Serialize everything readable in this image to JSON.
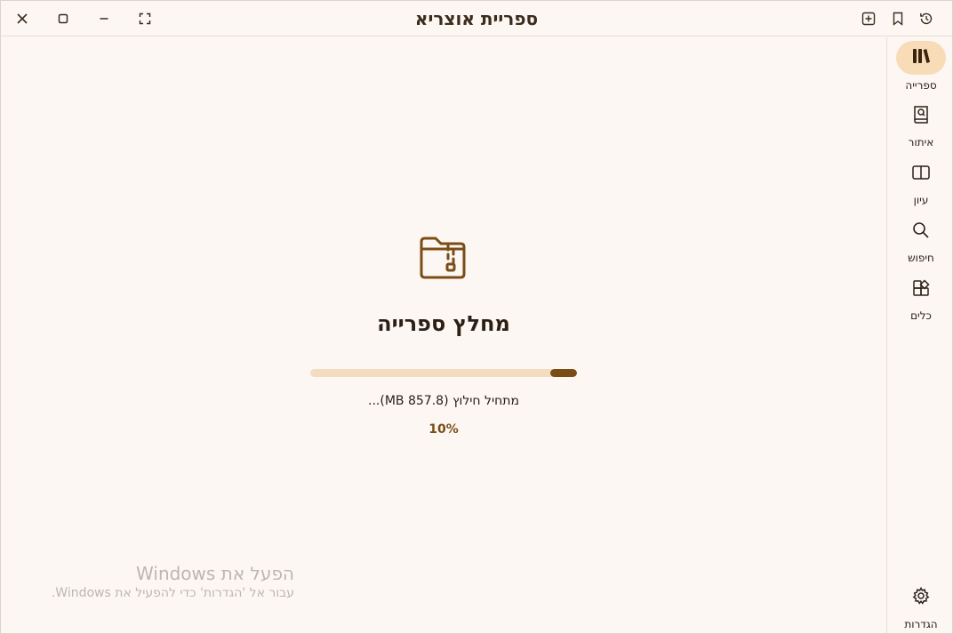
{
  "window": {
    "title": "ספריית אוצריא"
  },
  "titlebar": {
    "close_icon": "close-icon",
    "maximize_icon": "maximize-icon",
    "minimize_icon": "minimize-icon",
    "fullscreen_icon": "fullscreen-icon",
    "add_tab_icon": "add-tab-icon",
    "bookmark_icon": "bookmark-icon",
    "history_icon": "history-icon"
  },
  "main": {
    "icon": "zipped-folder-icon",
    "heading": "מחלץ ספרייה",
    "progress_fraction": 0.1,
    "status": "מתחיל חילוץ (857.8 MB)...",
    "percent": "10%"
  },
  "sidebar": {
    "items": [
      {
        "label": "ספרייה",
        "icon": "library-icon",
        "active": true
      },
      {
        "label": "איתור",
        "icon": "find-book-icon",
        "active": false
      },
      {
        "label": "עיון",
        "icon": "reading-icon",
        "active": false
      },
      {
        "label": "חיפוש",
        "icon": "search-icon",
        "active": false
      },
      {
        "label": "כלים",
        "icon": "tools-icon",
        "active": false
      }
    ],
    "settings": {
      "label": "הגדרות",
      "icon": "gear-icon"
    }
  },
  "watermark": {
    "title": "הפעל את Windows",
    "subtitle": "עבור אל 'הגדרות' כדי להפעיל את Windows."
  },
  "colors": {
    "background": "#fdf7f3",
    "accent": "#7a4d16",
    "progress_track": "#f3dcc0",
    "active_nav": "#f8dcb8",
    "text": "#2a2018"
  }
}
